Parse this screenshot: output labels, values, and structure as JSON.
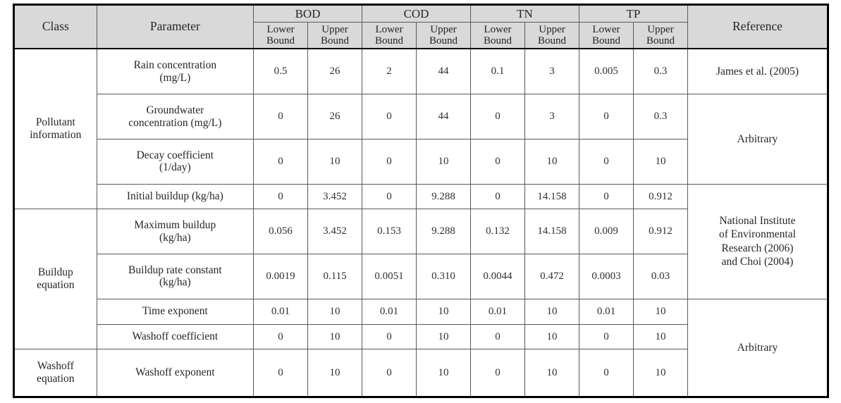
{
  "table": {
    "header": {
      "class_label": "Class",
      "parameter_label": "Parameter",
      "reference_label": "Reference",
      "groups": [
        "BOD",
        "COD",
        "TN",
        "TP"
      ],
      "bound_labels": {
        "lower": "Lower Bound",
        "upper": "Upper Bound"
      },
      "bound_line1": "Lower",
      "bound_line2": "Bound",
      "upper_line1": "Upper",
      "upper_line2": "Bound"
    },
    "classes": [
      {
        "label_line1": "Pollutant",
        "label_line2": "information",
        "rowspan": 4
      },
      {
        "label_line1": "Buildup",
        "label_line2": "equation",
        "rowspan": 4
      },
      {
        "label_line1": "Washoff",
        "label_line2": "equation",
        "rowspan": 2
      }
    ],
    "references": [
      {
        "text": "James et al. (2005)",
        "rowspan": 1,
        "lines": [
          "James et al. (2005)"
        ]
      },
      {
        "text": "Arbitrary",
        "rowspan": 2,
        "lines": [
          "Arbitrary"
        ]
      },
      {
        "text": "National Institute of Environmental Research (2006) and Choi (2004)",
        "rowspan": 3,
        "lines": [
          "National Institute",
          "of Environmental",
          "Research (2006)",
          "and Choi (2004)"
        ]
      },
      {
        "text": "Arbitrary",
        "rowspan": 3,
        "lines": [
          "Arbitrary"
        ]
      }
    ],
    "rows": [
      {
        "parameter_line1": "Rain  concentration",
        "parameter_line2": "(mg/L)",
        "values": [
          "0.5",
          "26",
          "2",
          "44",
          "0.1",
          "3",
          "0.005",
          "0.3"
        ]
      },
      {
        "parameter_line1": "Groundwater",
        "parameter_line2": "concentration (mg/L)",
        "values": [
          "0",
          "26",
          "0",
          "44",
          "0",
          "3",
          "0",
          "0.3"
        ]
      },
      {
        "parameter_line1": "Decay  coefficient",
        "parameter_line2": "(1/day)",
        "values": [
          "0",
          "10",
          "0",
          "10",
          "0",
          "10",
          "0",
          "10"
        ]
      },
      {
        "parameter_line1": "Initial  buildup (kg/ha)",
        "parameter_line2": "",
        "values": [
          "0",
          "3.452",
          "0",
          "9.288",
          "0",
          "14.158",
          "0",
          "0.912"
        ]
      },
      {
        "parameter_line1": "Maximum  buildup",
        "parameter_line2": "(kg/ha)",
        "values": [
          "0.056",
          "3.452",
          "0.153",
          "9.288",
          "0.132",
          "14.158",
          "0.009",
          "0.912"
        ]
      },
      {
        "parameter_line1": "Buildup  rate  constant",
        "parameter_line2": "(kg/ha)",
        "values": [
          "0.0019",
          "0.115",
          "0.0051",
          "0.310",
          "0.0044",
          "0.472",
          "0.0003",
          "0.03"
        ]
      },
      {
        "parameter_line1": "Time  exponent",
        "parameter_line2": "",
        "values": [
          "0.01",
          "10",
          "0.01",
          "10",
          "0.01",
          "10",
          "0.01",
          "10"
        ]
      },
      {
        "parameter_line1": "Washoff  coefficient",
        "parameter_line2": "",
        "values": [
          "0",
          "10",
          "0",
          "10",
          "0",
          "10",
          "0",
          "10"
        ]
      },
      {
        "parameter_line1": "Washoff  exponent",
        "parameter_line2": "",
        "values": [
          "0",
          "10",
          "0",
          "10",
          "0",
          "10",
          "0",
          "10"
        ]
      }
    ]
  },
  "colors": {
    "header_background": "#d9d9d9",
    "border": "#595959",
    "outer_border": "#000000",
    "text": "#262626",
    "page_background": "#ffffff"
  }
}
